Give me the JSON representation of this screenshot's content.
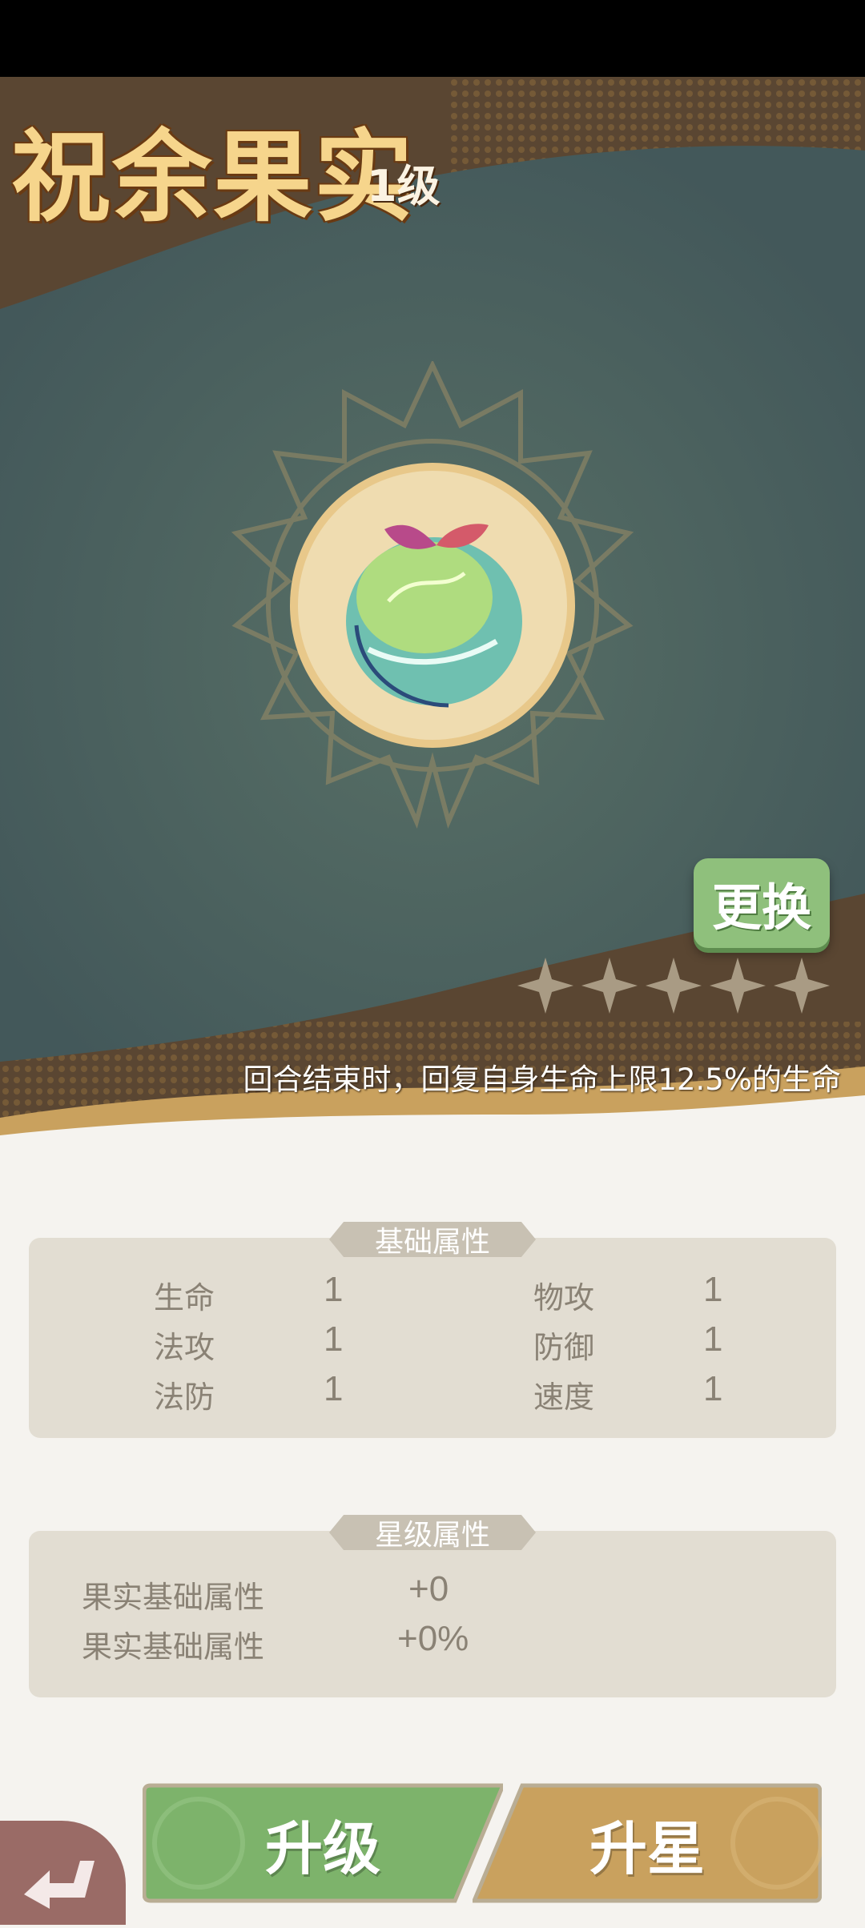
{
  "header": {
    "title": "祝余果实",
    "level": "1级"
  },
  "item": {
    "icon": "peach-fruit-icon",
    "replace_label": "更换",
    "stars_total": 5,
    "stars_filled": 0,
    "description": "回合结束时，回复自身生命上限12.5%的生命"
  },
  "base_attributes": {
    "title": "基础属性",
    "rows": [
      {
        "left_label": "生命",
        "left_value": "1",
        "right_label": "物攻",
        "right_value": "1"
      },
      {
        "left_label": "法攻",
        "left_value": "1",
        "right_label": "防御",
        "right_value": "1"
      },
      {
        "left_label": "法防",
        "left_value": "1",
        "right_label": "速度",
        "right_value": "1"
      }
    ]
  },
  "star_attributes": {
    "title": "星级属性",
    "rows": [
      {
        "label": "果实基础属性",
        "value": "+0"
      },
      {
        "label": "果实基础属性",
        "value": "+0%"
      }
    ]
  },
  "actions": {
    "upgrade_label": "升级",
    "star_up_label": "升星",
    "back_icon": "back-arrow-icon"
  },
  "colors": {
    "upgrade": "#7db36b",
    "star_up": "#c9a15e",
    "replace": "#8fc07c",
    "hero_teal": "#4a5f5c",
    "hero_brown": "#5a4632"
  }
}
